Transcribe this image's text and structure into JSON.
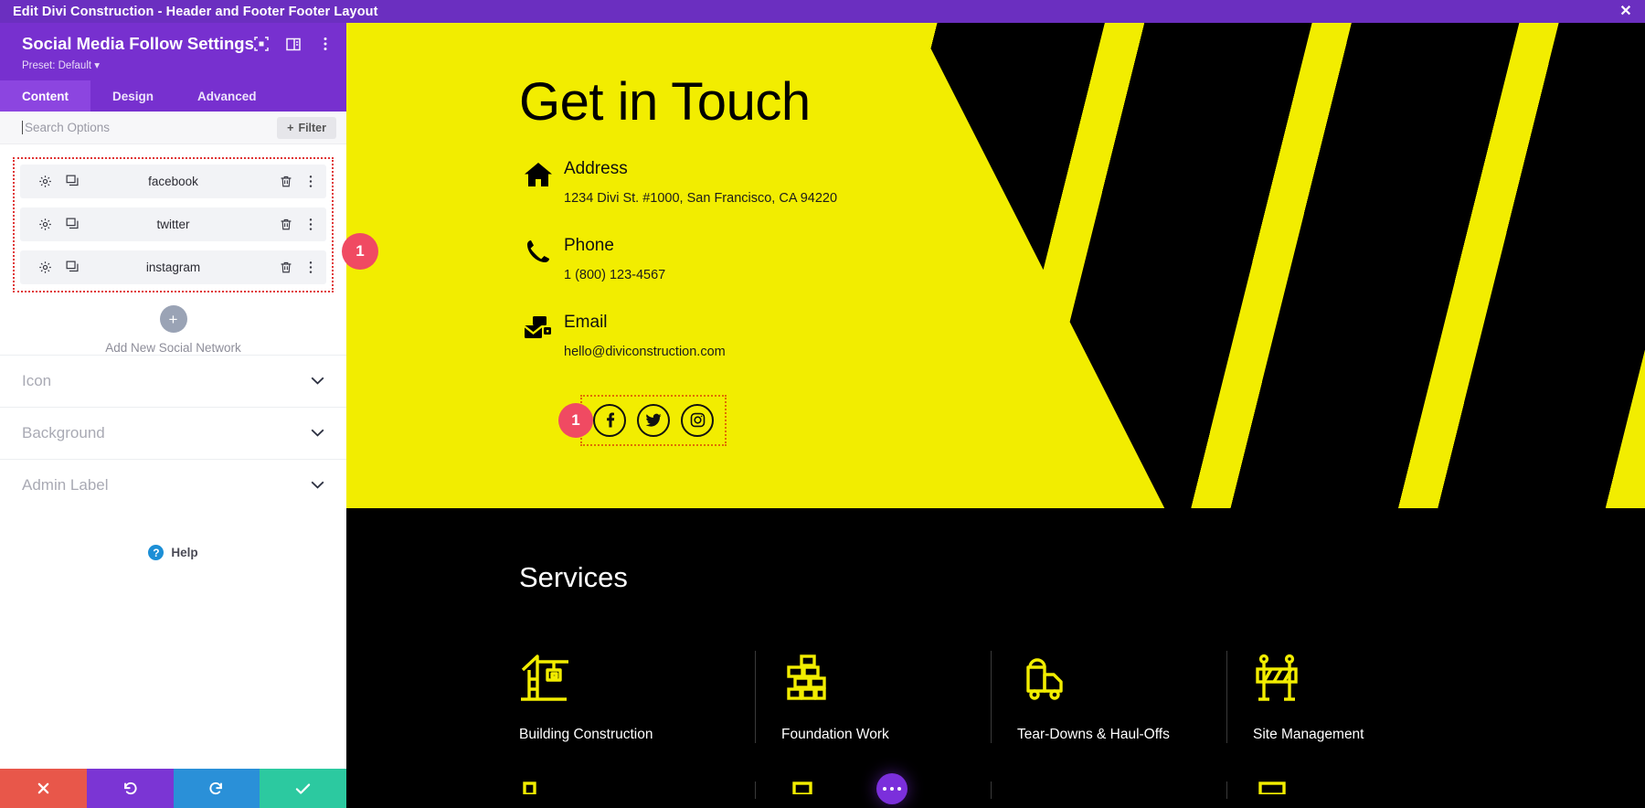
{
  "titlebar": {
    "text": "Edit Divi Construction - Header and Footer Footer Layout",
    "close_icon": "close-icon"
  },
  "panel": {
    "title": "Social Media Follow Settings",
    "preset": "Preset: Default",
    "header_icons": [
      "focus-target-icon",
      "panel-layout-icon",
      "kebab-menu-icon"
    ],
    "tabs": [
      {
        "label": "Content",
        "active": true
      },
      {
        "label": "Design",
        "active": false
      },
      {
        "label": "Advanced",
        "active": false
      }
    ],
    "search": {
      "placeholder": "Search Options",
      "value": "",
      "filter_label": "Filter"
    },
    "social_networks": [
      {
        "label": "facebook"
      },
      {
        "label": "twitter"
      },
      {
        "label": "instagram"
      }
    ],
    "row_icons": {
      "settings": "gear-icon",
      "duplicate": "duplicate-icon",
      "delete": "trash-icon",
      "more": "kebab-menu-icon"
    },
    "add_new": {
      "label": "Add New Social Network",
      "icon": "plus-icon"
    },
    "accordions": [
      {
        "label": "Icon",
        "icon": "chevron-down-icon"
      },
      {
        "label": "Background",
        "icon": "chevron-down-icon"
      },
      {
        "label": "Admin Label",
        "icon": "chevron-down-icon"
      }
    ],
    "help": {
      "label": "Help",
      "icon": "question-mark-icon"
    },
    "bottom_bar": [
      {
        "name": "cancel",
        "icon": "close-icon",
        "color": "#e8574a"
      },
      {
        "name": "undo",
        "icon": "undo-icon",
        "color": "#7b35d4"
      },
      {
        "name": "redo",
        "icon": "redo-icon",
        "color": "#2a90d8"
      },
      {
        "name": "save",
        "icon": "checkmark-icon",
        "color": "#2cc9a0"
      }
    ]
  },
  "canvas": {
    "hero": {
      "heading": "Get in Touch",
      "contacts": [
        {
          "icon": "home-icon",
          "title": "Address",
          "value": "1234 Divi St. #1000, San Francisco, CA 94220"
        },
        {
          "icon": "phone-icon",
          "title": "Phone",
          "value": "1 (800) 123-4567"
        },
        {
          "icon": "email-icon",
          "title": "Email",
          "value": "hello@diviconstruction.com"
        }
      ],
      "social_badge": "1",
      "social_icons": [
        {
          "name": "facebook-icon"
        },
        {
          "name": "twitter-icon"
        },
        {
          "name": "instagram-icon"
        }
      ]
    },
    "services": {
      "heading": "Services",
      "items": [
        {
          "icon": "crane-icon",
          "label": "Building Construction"
        },
        {
          "icon": "bricks-icon",
          "label": "Foundation Work"
        },
        {
          "icon": "truck-icon",
          "label": "Tear-Downs & Haul-Offs"
        },
        {
          "icon": "barricade-icon",
          "label": "Site Management"
        }
      ]
    },
    "fab": {
      "icon": "ellipsis-icon"
    }
  },
  "badges": {
    "list_badge": "1"
  },
  "colors": {
    "brand_purple": "#7730cf",
    "titlebar_purple": "#6b2fc0",
    "accent_yellow": "#f2ed00",
    "badge_red": "#f04a62",
    "selection_red": "#e03434",
    "selection_orange": "#e07000"
  }
}
